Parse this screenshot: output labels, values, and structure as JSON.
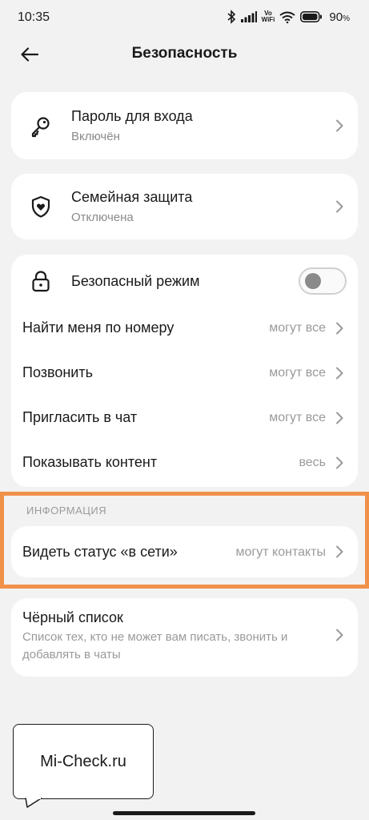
{
  "status": {
    "time": "10:35",
    "vowifi_top": "Vo",
    "vowifi_bottom": "WiFi",
    "battery": "90",
    "battery_unit": "%"
  },
  "header": {
    "title": "Безопасность",
    "back_icon": "arrow-left-icon"
  },
  "cards": {
    "password": {
      "title": "Пароль для входа",
      "subtitle": "Включён",
      "icon": "key-icon"
    },
    "family": {
      "title": "Семейная защита",
      "subtitle": "Отключена",
      "icon": "shield-heart-icon"
    },
    "privacy": {
      "safe_mode": {
        "title": "Безопасный режим",
        "icon": "lock-icon",
        "enabled": false
      },
      "rows": [
        {
          "title": "Найти меня по номеру",
          "value": "могут все"
        },
        {
          "title": "Позвонить",
          "value": "могут все"
        },
        {
          "title": "Пригласить в чат",
          "value": "могут все"
        },
        {
          "title": "Показывать контент",
          "value": "весь"
        }
      ]
    },
    "info": {
      "section_label": "ИНФОРМАЦИЯ",
      "online_status": {
        "title": "Видеть статус «в сети»",
        "value": "могут контакты"
      }
    },
    "blacklist": {
      "title": "Чёрный список",
      "description": "Список тех, кто не может вам писать, звонить и добавлять в чаты"
    }
  },
  "watermark": {
    "text": "Mi-Check.ru"
  },
  "colors": {
    "highlight": "#f0914a",
    "background": "#f2f2f2",
    "card": "#ffffff"
  }
}
